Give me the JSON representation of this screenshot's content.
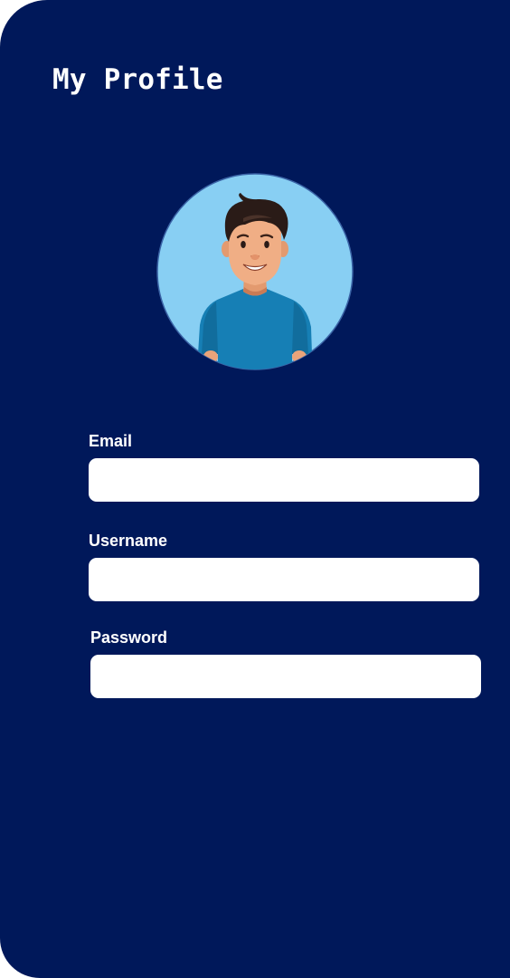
{
  "header": {
    "title": "My Profile"
  },
  "profile": {
    "avatar_icon": "user-avatar-illustration"
  },
  "form": {
    "email": {
      "label": "Email",
      "value": "",
      "placeholder": ""
    },
    "username": {
      "label": "Username",
      "value": "",
      "placeholder": ""
    },
    "password": {
      "label": "Password",
      "value": "",
      "placeholder": ""
    }
  },
  "colors": {
    "background": "#00185a",
    "input_background": "#ffffff",
    "text": "#ffffff",
    "avatar_background": "#88cff3",
    "shirt": "#167fb5"
  }
}
